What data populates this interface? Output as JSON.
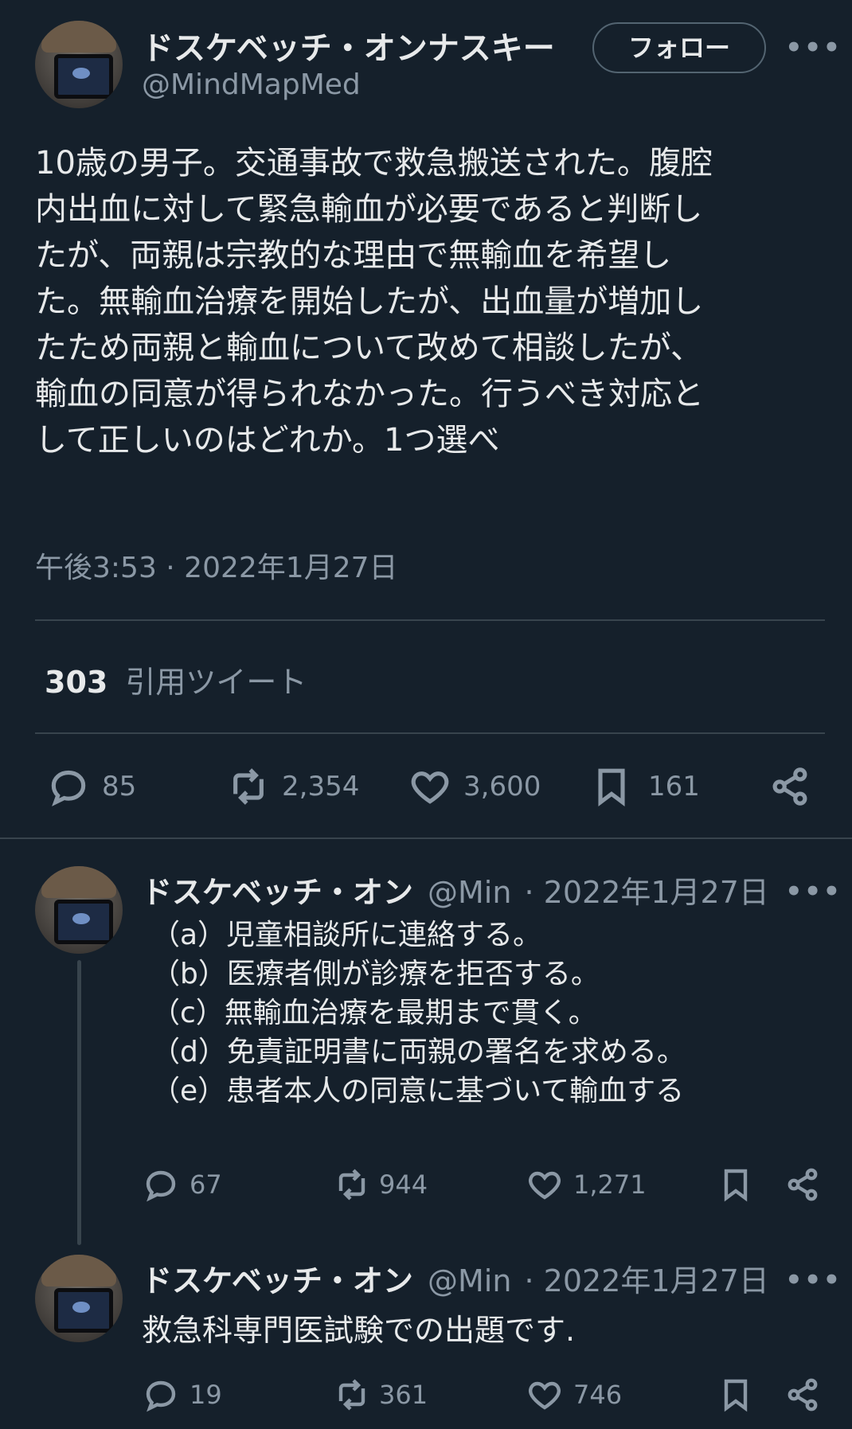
{
  "main": {
    "author_name": "ドスケベッチ・オンナスキー",
    "handle": "@MindMapMed",
    "follow_label": "フォロー",
    "more": "•••",
    "lines": [
      "10歳の男子。交通事故で救急搬送された。腹腔",
      "内出血に対して緊急輸血が必要であると判断し",
      "たが、両親は宗教的な理由で無輸血を希望し",
      "た。無輸血治療を開始したが、出血量が増加し",
      "たため両親と輸血について改めて相談したが、",
      "輸血の同意が得られなかった。行うべき対応と",
      "して正しいのはどれか。1つ選べ"
    ],
    "timestamp": "午後3:53 · 2022年1月27日",
    "quote_count": "303",
    "quote_label": "引用ツイート",
    "replies": "85",
    "retweets": "2,354",
    "likes": "3,600",
    "bookmarks": "161"
  },
  "reply1": {
    "name": "ドスケベッチ・オン",
    "handle": "@Min",
    "date": "· 2022年1月27日",
    "more": "•••",
    "options": [
      "（a）児童相談所に連絡する。",
      "（b）医療者側が診療を拒否する。",
      "（c）無輸血治療を最期まで貫く。",
      "（d）免責証明書に両親の署名を求める。",
      "（e）患者本人の同意に基づいて輸血する"
    ],
    "replies": "67",
    "retweets": "944",
    "likes": "1,271"
  },
  "reply2": {
    "name": "ドスケベッチ・オン",
    "handle": "@Min",
    "date": "· 2022年1月27日",
    "more": "•••",
    "text": "救急科専門医試験での出題です.",
    "replies": "19",
    "retweets": "361",
    "likes": "746"
  },
  "colors": {
    "background": "#15202b",
    "text": "#e7e9ea",
    "muted": "#8b98a5",
    "divider": "#38444d"
  }
}
